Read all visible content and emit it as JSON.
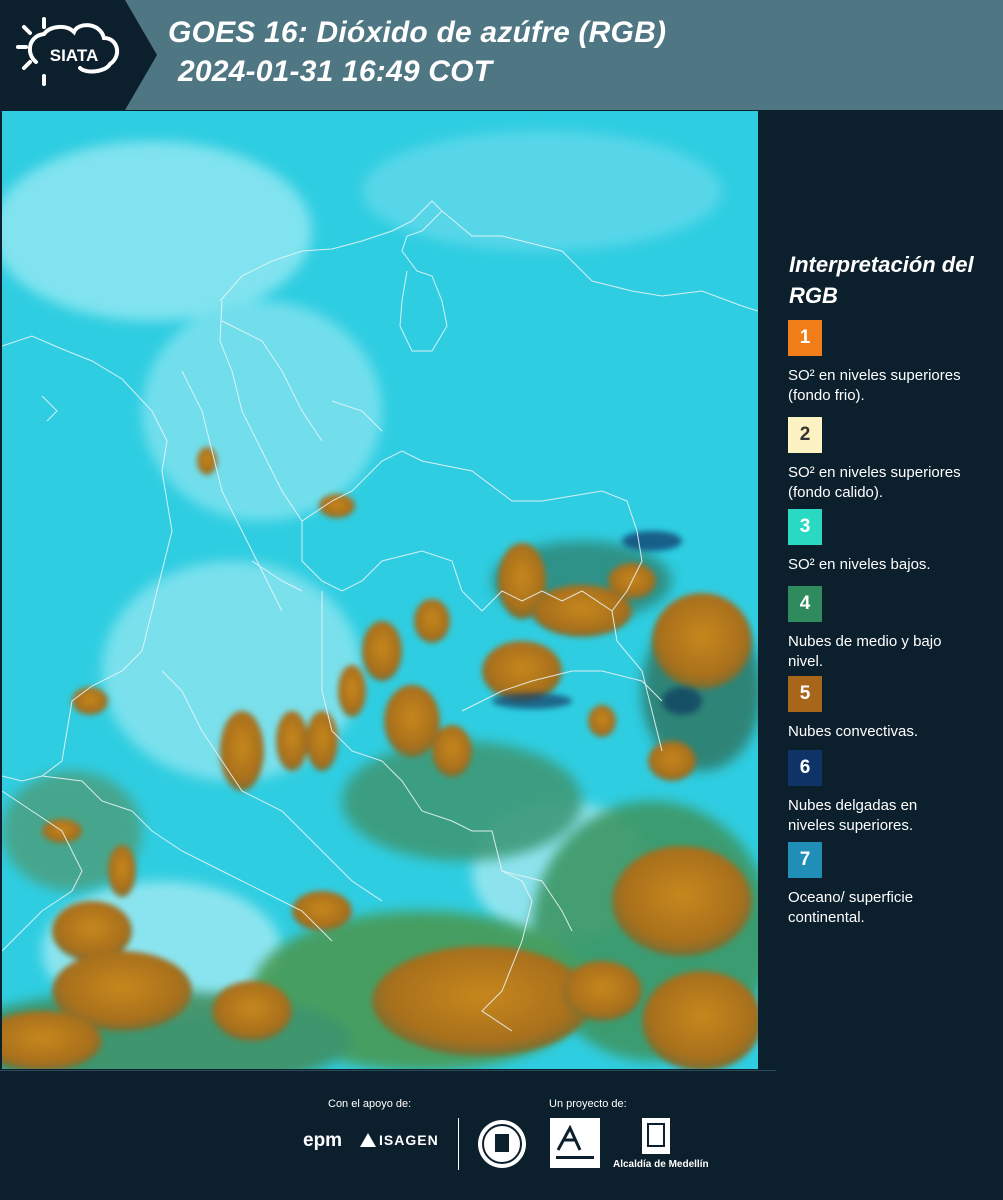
{
  "header": {
    "logo_text": "SIATA",
    "title_line1": "GOES 16: Dióxido de azúfre (RGB)",
    "title_line2": "2024-01-31 16:49 COT"
  },
  "colors": {
    "background": "#0c1f2c",
    "header_band": "#4f7683",
    "map_base": "#2ecde0",
    "boundary": "#e8f4f8"
  },
  "map": {
    "icon": "satellite-rgb-composite"
  },
  "legend": {
    "title": "Interpretación del RGB",
    "items": [
      {
        "number": "1",
        "label": "SO² en niveles superiores (fondo frio).",
        "color": "#f07d17"
      },
      {
        "number": "2",
        "label": "SO² en niveles superiores (fondo calido).",
        "color": "#fdf2c2"
      },
      {
        "number": "3",
        "label": "SO² en niveles bajos.",
        "color": "#2ad9c2"
      },
      {
        "number": "4",
        "label": "Nubes de medio y bajo nivel.",
        "color": "#2f8a5e"
      },
      {
        "number": "5",
        "label": "Nubes convectivas.",
        "color": "#a7661a"
      },
      {
        "number": "6",
        "label": "Nubes delgadas en niveles superiores.",
        "color": "#0e3366"
      },
      {
        "number": "7",
        "label": "Oceano/ superficie continental.",
        "color": "#1f8fb7"
      }
    ]
  },
  "footer": {
    "support_caption": "Con el apoyo de:",
    "project_caption": "Un proyecto de:",
    "sponsor1": "epm",
    "sponsor2": "ISAGEN",
    "partner_text": "Alcaldía de Medellín"
  }
}
